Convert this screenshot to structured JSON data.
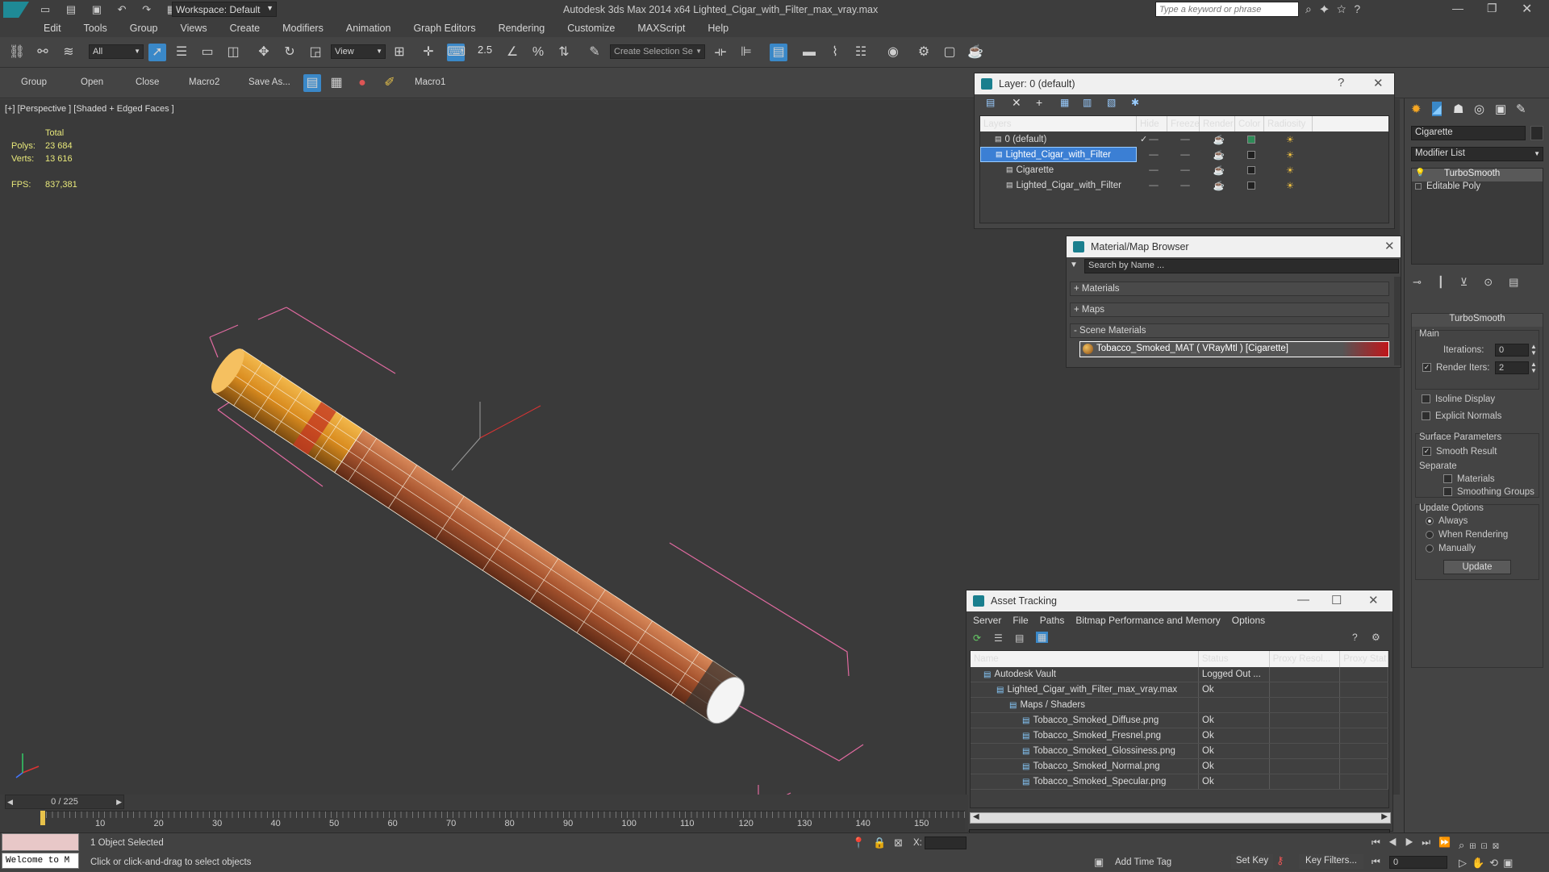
{
  "app": {
    "title": "Autodesk 3ds Max  2014 x64    Lighted_Cigar_with_Filter_max_vray.max",
    "workspace": "Workspace: Default",
    "search_placeholder": "Type a keyword or phrase"
  },
  "menu": [
    "Edit",
    "Tools",
    "Group",
    "Views",
    "Create",
    "Modifiers",
    "Animation",
    "Graph Editors",
    "Rendering",
    "Customize",
    "MAXScript",
    "Help"
  ],
  "toolbar": {
    "filter": "All",
    "ref_coord": "View",
    "selection_set": "Create Selection Se",
    "snap_value": "2.5"
  },
  "toolbar2": [
    "Group",
    "Open",
    "Close",
    "Macro2",
    "Save As...",
    "Macro1"
  ],
  "viewport": {
    "label": "[+] [Perspective ] [Shaded + Edged Faces ]",
    "stats_total": "Total",
    "polys_label": "Polys:",
    "polys": "23 684",
    "verts_label": "Verts:",
    "verts": "13 616",
    "fps_label": "FPS:",
    "fps": "837,381"
  },
  "layer_window": {
    "title": "Layer: 0 (default)",
    "columns": [
      "Layers",
      "Hide",
      "Freeze",
      "Render",
      "Color",
      "Radiosity"
    ],
    "rows": [
      {
        "name": "0 (default)",
        "indent": 1,
        "color": "#2e8b57",
        "selected": false,
        "check": true
      },
      {
        "name": "Lighted_Cigar_with_Filter",
        "indent": 1,
        "color": "#202020",
        "selected": true,
        "check": false
      },
      {
        "name": "Cigarette",
        "indent": 2,
        "color": "#202020",
        "selected": false,
        "check": false
      },
      {
        "name": "Lighted_Cigar_with_Filter",
        "indent": 2,
        "color": "#202020",
        "selected": false,
        "check": false
      }
    ]
  },
  "material_browser": {
    "title": "Material/Map Browser",
    "search_placeholder": "Search by Name ...",
    "sections": [
      "+ Materials",
      "+ Maps",
      "- Scene Materials"
    ],
    "scene_material": "Tobacco_Smoked_MAT  ( VRayMtl )  [Cigarette]"
  },
  "command_panel": {
    "object_name": "Cigarette",
    "modifier_list": "Modifier List",
    "stack": [
      "TurboSmooth",
      "Editable Poly"
    ],
    "rollout": "TurboSmooth",
    "main_label": "Main",
    "iterations_label": "Iterations:",
    "iterations": "0",
    "render_iters_label": "Render Iters:",
    "render_iters": "2",
    "isoline": "Isoline Display",
    "explicit_normals": "Explicit Normals",
    "surface_params": "Surface Parameters",
    "smooth_result": "Smooth Result",
    "separate": "Separate",
    "materials": "Materials",
    "smoothing_groups": "Smoothing Groups",
    "update_options": "Update Options",
    "always": "Always",
    "when_rendering": "When Rendering",
    "manually": "Manually",
    "update_btn": "Update"
  },
  "asset_tracking": {
    "title": "Asset Tracking",
    "menu": [
      "Server",
      "File",
      "Paths",
      "Bitmap Performance and Memory",
      "Options"
    ],
    "columns": [
      "Name",
      "Status",
      "Proxy Resol...",
      "Proxy Stat"
    ],
    "rows": [
      {
        "name": "Autodesk Vault",
        "status": "Logged Out ...",
        "indent": 1
      },
      {
        "name": "Lighted_Cigar_with_Filter_max_vray.max",
        "status": "Ok",
        "indent": 2
      },
      {
        "name": "Maps / Shaders",
        "status": "",
        "indent": 3
      },
      {
        "name": "Tobacco_Smoked_Diffuse.png",
        "status": "Ok",
        "indent": 4
      },
      {
        "name": "Tobacco_Smoked_Fresnel.png",
        "status": "Ok",
        "indent": 4
      },
      {
        "name": "Tobacco_Smoked_Glossiness.png",
        "status": "Ok",
        "indent": 4
      },
      {
        "name": "Tobacco_Smoked_Normal.png",
        "status": "Ok",
        "indent": 4
      },
      {
        "name": "Tobacco_Smoked_Specular.png",
        "status": "Ok",
        "indent": 4
      }
    ]
  },
  "timeline": {
    "frame": "0 / 225",
    "ticks": [
      "10",
      "20",
      "30",
      "40",
      "50",
      "60",
      "70",
      "80",
      "90",
      "100",
      "110",
      "120",
      "130",
      "140",
      "150"
    ]
  },
  "status": {
    "welcome": "Welcome to M",
    "selected": "1 Object Selected",
    "hint": "Click or click-and-drag to select objects",
    "x_label": "X:",
    "add_time_tag": "Add Time Tag",
    "set_key": "Set Key",
    "key_filters": "Key Filters...",
    "frame_field": "0"
  }
}
